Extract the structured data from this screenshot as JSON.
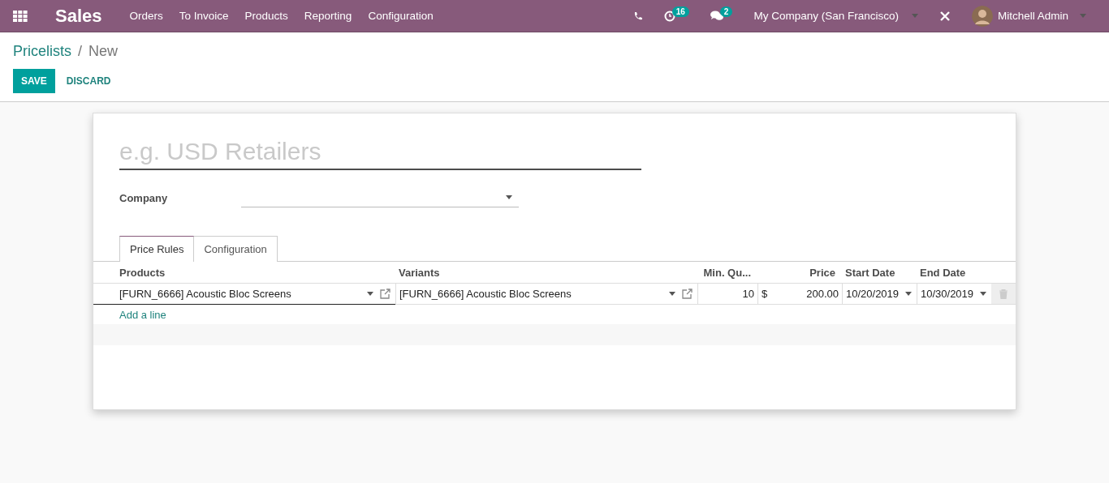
{
  "navbar": {
    "app": "Sales",
    "menu": [
      "Orders",
      "To Invoice",
      "Products",
      "Reporting",
      "Configuration"
    ],
    "activity_count": "16",
    "message_count": "2",
    "company": "My Company (San Francisco)",
    "user": "Mitchell Admin"
  },
  "breadcrumb": {
    "parent": "Pricelists",
    "separator": "/",
    "current": "New"
  },
  "buttons": {
    "save": "SAVE",
    "discard": "DISCARD"
  },
  "form": {
    "name_placeholder": "e.g. USD Retailers",
    "company_label": "Company",
    "tabs": [
      {
        "label": "Price Rules",
        "selected": true
      },
      {
        "label": "Configuration",
        "selected": false
      }
    ],
    "columns": [
      "Products",
      "Variants",
      "Min. Qu...",
      "Price",
      "Start Date",
      "End Date"
    ],
    "rows": [
      {
        "product": "[FURN_6666] Acoustic Bloc Screens",
        "variant": "[FURN_6666] Acoustic Bloc Screens",
        "min_qty": "10",
        "currency": "$",
        "price": "200.00",
        "start_date": "10/20/2019",
        "end_date": "10/30/2019"
      }
    ],
    "add_line": "Add a line"
  }
}
